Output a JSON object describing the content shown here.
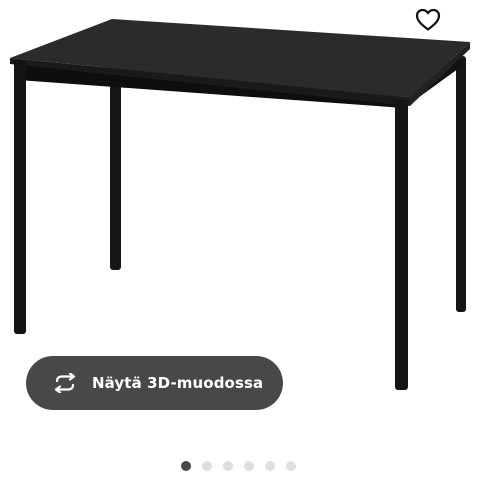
{
  "product": {
    "image_alt": "black rectangular table",
    "image_icon": "table-image",
    "favourite_icon": "heart-outline-icon"
  },
  "view_3d": {
    "label": "Näytä 3D-muodossa",
    "icon": "rotate-arrows-icon"
  },
  "carousel": {
    "total": 6,
    "active_index": 0
  },
  "colors": {
    "button_bg": "#484848",
    "button_text": "#ffffff",
    "dot_active": "#484848",
    "dot_inactive": "#dfdfdf",
    "table": "#1b1b1b"
  }
}
